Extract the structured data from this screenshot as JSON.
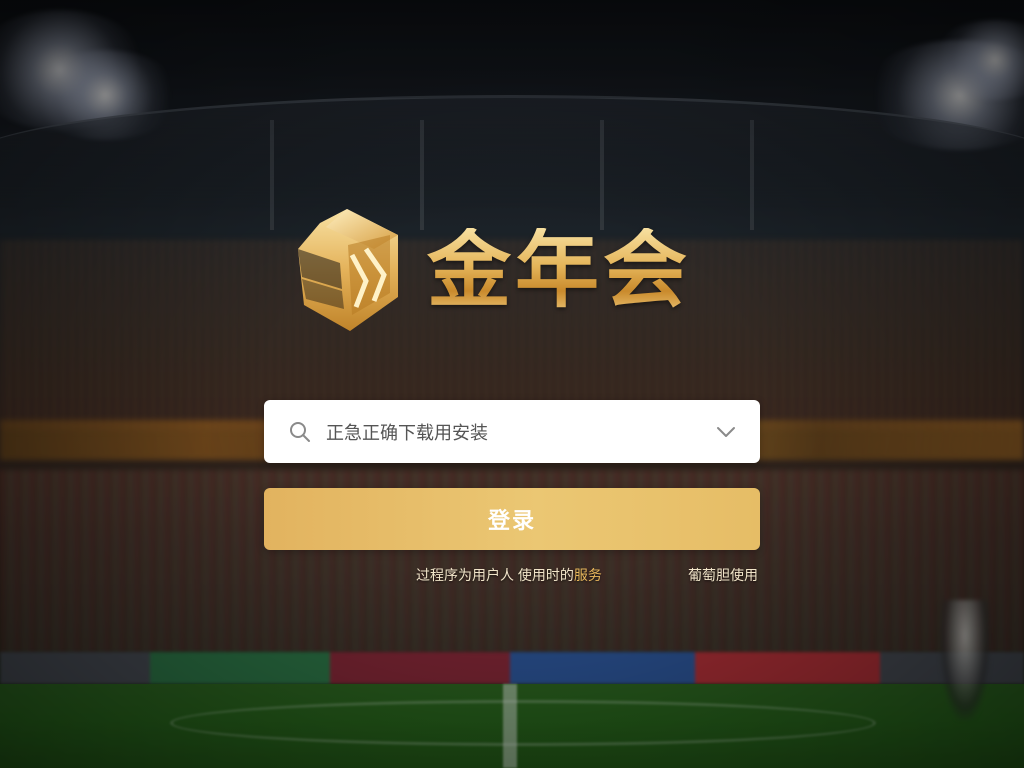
{
  "brand": {
    "name": "金年会",
    "logo_icon": "shield-cube-logo-icon"
  },
  "login_form": {
    "select_value": "正急正确下载用安装",
    "search_icon": "search-icon",
    "dropdown_icon": "chevron-down-icon",
    "login_label": "登录"
  },
  "footer": {
    "notice_prefix": "过程序为用户人 使用时的",
    "notice_highlight": "服务",
    "right_link": "葡萄胆使用"
  },
  "colors": {
    "accent_gold": "#E6BD66",
    "brand_gold_light": "#F7E0A0",
    "brand_gold_dark": "#C98A2C",
    "input_bg": "#FFFFFF"
  }
}
